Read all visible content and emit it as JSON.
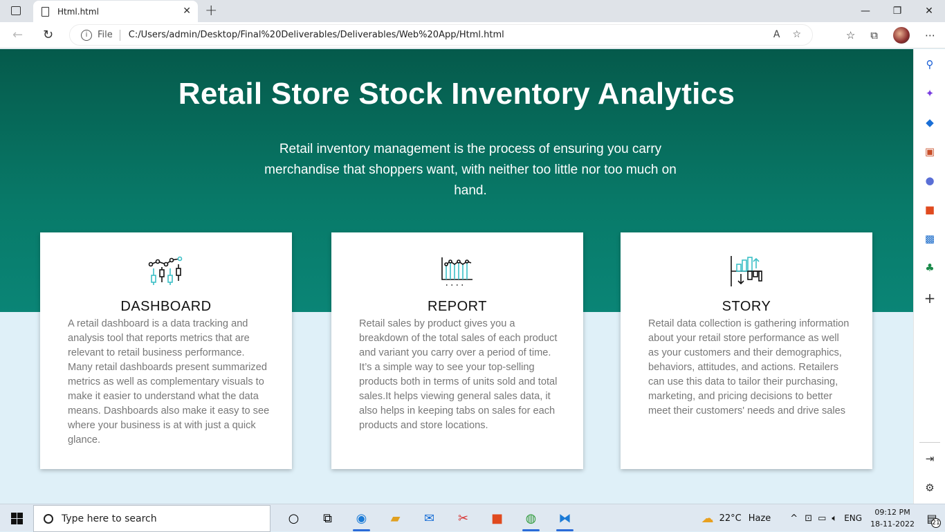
{
  "browser": {
    "tab_title": "Html.html",
    "url_prefix": "File",
    "url": "C:/Users/admin/Desktop/Final%20Deliverables/Deliverables/Web%20App/Html.html"
  },
  "hero": {
    "title": "Retail Store Stock Inventory Analytics",
    "subtitle": "Retail inventory management is the process of ensuring you carry merchandise that shoppers want, with neither too little nor too much on hand."
  },
  "cards": [
    {
      "icon": "candlestick-chart-icon",
      "title": "DASHBOARD",
      "body": "A retail dashboard is a data tracking and analysis tool that reports metrics that are relevant to retail business performance. Many retail dashboards present summarized metrics as well as complementary visuals to make it easier to understand what the data means. Dashboards also make it easy to see where your business is at with just a quick glance."
    },
    {
      "icon": "line-chart-icon",
      "title": "REPORT",
      "body": "Retail sales by product gives you a breakdown of the total sales of each product and variant you carry over a period of time. It’s a simple way to see your top-selling products both in terms of units sold and total sales.It helps viewing general sales data, it also helps in keeping tabs on sales for each products and store locations."
    },
    {
      "icon": "bar-chart-arrows-icon",
      "title": "STORY",
      "body": "Retail data collection is gathering information about your retail store performance as well as your customers and their demographics, behaviors, attitudes, and actions. Retailers can use this data to tailor their purchasing, marketing, and pricing decisions to better meet their customers' needs and drive sales"
    }
  ],
  "taskbar": {
    "search_placeholder": "Type here to search",
    "weather_temp": "22°C",
    "weather_desc": "Haze",
    "language": "ENG",
    "time": "09:12 PM",
    "date": "18-11-2022",
    "notification_count": "21"
  },
  "colors": {
    "hero_top": "#055a4b",
    "hero_bottom": "#0a8576",
    "page_bg": "#dff0f8",
    "icon_accent": "#3bbfc6"
  }
}
